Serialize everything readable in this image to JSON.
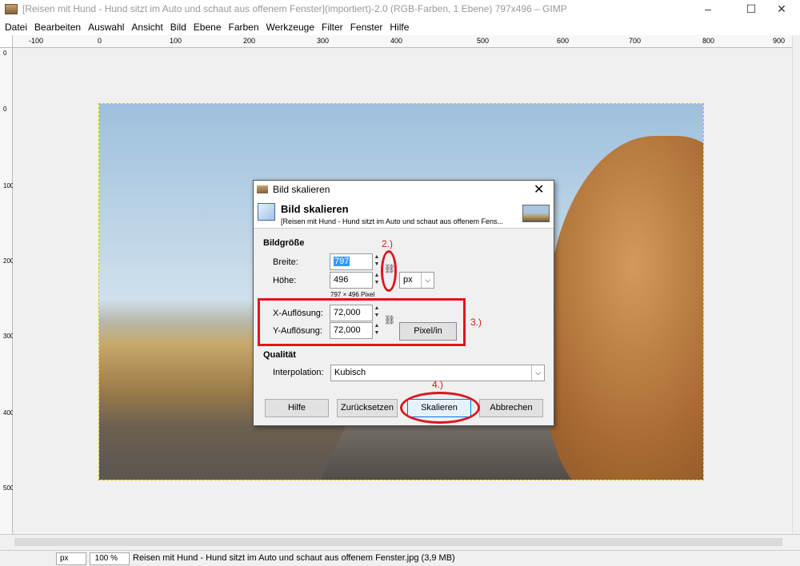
{
  "window": {
    "title": "[Reisen mit Hund - Hund sitzt im Auto und schaut aus offenem Fenster](importiert)-2.0 (RGB-Farben, 1 Ebene) 797x496 – GIMP",
    "minimize": "–",
    "maximize": "☐",
    "close": "✕"
  },
  "menu": [
    "Datei",
    "Bearbeiten",
    "Auswahl",
    "Ansicht",
    "Bild",
    "Ebene",
    "Farben",
    "Werkzeuge",
    "Filter",
    "Fenster",
    "Hilfe"
  ],
  "ruler": {
    "h_ticks": [
      "-100",
      "0",
      "100",
      "200",
      "300",
      "400",
      "500",
      "600",
      "700",
      "800",
      "900"
    ],
    "v_ticks": [
      "0",
      "0",
      "100",
      "200",
      "300",
      "400",
      "500"
    ]
  },
  "dialog": {
    "title": "Bild skalieren",
    "close": "✕",
    "header_title": "Bild skalieren",
    "header_subtitle": "[Reisen mit Hund - Hund sitzt im Auto und schaut aus offenem Fens...",
    "section_size": "Bildgröße",
    "width_label": "Breite:",
    "width_value": "797",
    "height_label": "Höhe:",
    "height_value": "496",
    "size_unit": "px",
    "pixel_info": "797 × 496 Pixel",
    "xres_label": "X-Auflösung:",
    "xres_value": "72,000",
    "yres_label": "Y-Auflösung:",
    "yres_value": "72,000",
    "res_unit": "Pixel/in",
    "section_quality": "Qualität",
    "interp_label": "Interpolation:",
    "interp_value": "Kubisch",
    "btn_help": "Hilfe",
    "btn_reset": "Zurücksetzen",
    "btn_scale": "Skalieren",
    "btn_cancel": "Abbrechen"
  },
  "annotations": {
    "n2": "2.)",
    "n3": "3.)",
    "n4": "4.)",
    "color": "#e0141e"
  },
  "statusbar": {
    "unit": "px",
    "zoom": "100 %",
    "message": "Reisen mit Hund - Hund sitzt im Auto und schaut aus offenem Fenster.jpg (3,9 MB)"
  }
}
